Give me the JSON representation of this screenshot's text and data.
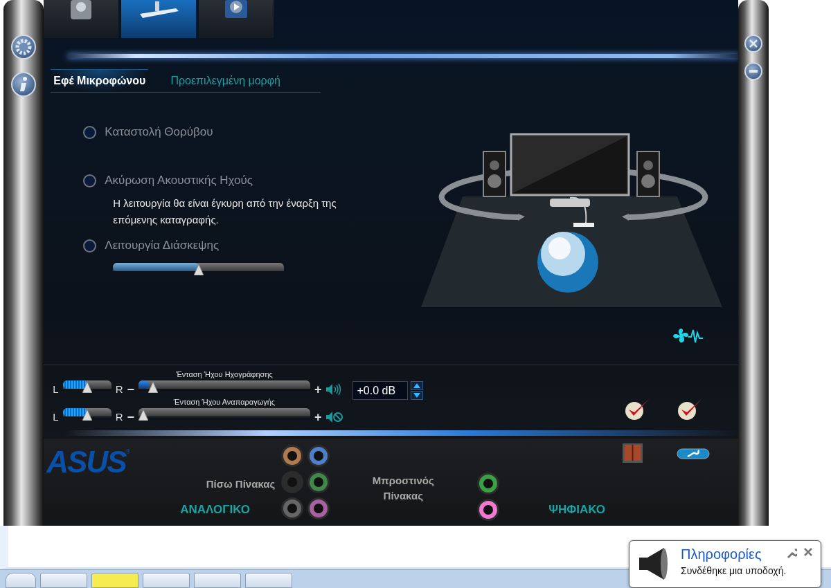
{
  "device_tabs": [
    {
      "selected": false
    },
    {
      "selected": true
    },
    {
      "selected": false
    }
  ],
  "effect_tabs": [
    {
      "label": "Εφέ Μικροφώνου",
      "selected": true
    },
    {
      "label": "Προεπιλεγμένη μορφή",
      "selected": false
    }
  ],
  "effects": [
    {
      "label": "Καταστολή Θορύβου",
      "checked": false
    },
    {
      "label": "Ακύρωση Ακουστικής Ηχούς",
      "checked": false,
      "note": "Η λειτουργία θα είναι έγκυρη από την έναρξη της επόμενης καταγραφής."
    },
    {
      "label": "Λειτουργία Διάσκεψης",
      "checked": false,
      "level": 0.5
    }
  ],
  "volumes": [
    {
      "title": "Ένταση Ήχου Ηχογράφησης",
      "left": "L",
      "right": "R",
      "minus": "−",
      "plus": "+",
      "balance": {
        "level": 0.5
      },
      "volume": {
        "level": 0.06
      },
      "muted": false
    },
    {
      "title": "Ένταση Ήχου Αναπαραγωγής",
      "left": "L",
      "right": "R",
      "minus": "−",
      "plus": "+",
      "balance": {
        "level": 0.5
      },
      "volume": {
        "level": 0.0
      },
      "muted": true
    }
  ],
  "gain": {
    "value": "+0.0 dB"
  },
  "logo": {
    "text": "ASUS",
    "mark": "®"
  },
  "rear_panel": {
    "label": "Πίσω Πίνακας",
    "ports": [
      {
        "color": "#b07a4e"
      },
      {
        "color": "#4f7fc6"
      },
      {
        "color": "#2c2c2c"
      },
      {
        "color": "#3f8a48"
      },
      {
        "color": "#666666"
      },
      {
        "color": "#a8609e"
      }
    ]
  },
  "front_panel": {
    "label_lines": [
      "Μπροστινός",
      "Πίνακας"
    ],
    "ports": [
      {
        "color": "#3aa043"
      },
      {
        "color": "#f07ad0"
      }
    ]
  },
  "analog_label": "ΑΝΑΛΟΓΙΚΟ",
  "digital_label": "ΨΗΦΙΑΚΟ",
  "notification": {
    "title": "Πληροφορίες",
    "message": "Συνδέθηκε μια υποδοχή."
  },
  "taskbar": [
    {
      "selected": false
    },
    {
      "selected": false
    },
    {
      "selected": true
    },
    {
      "selected": false
    },
    {
      "selected": false
    },
    {
      "selected": false
    }
  ]
}
